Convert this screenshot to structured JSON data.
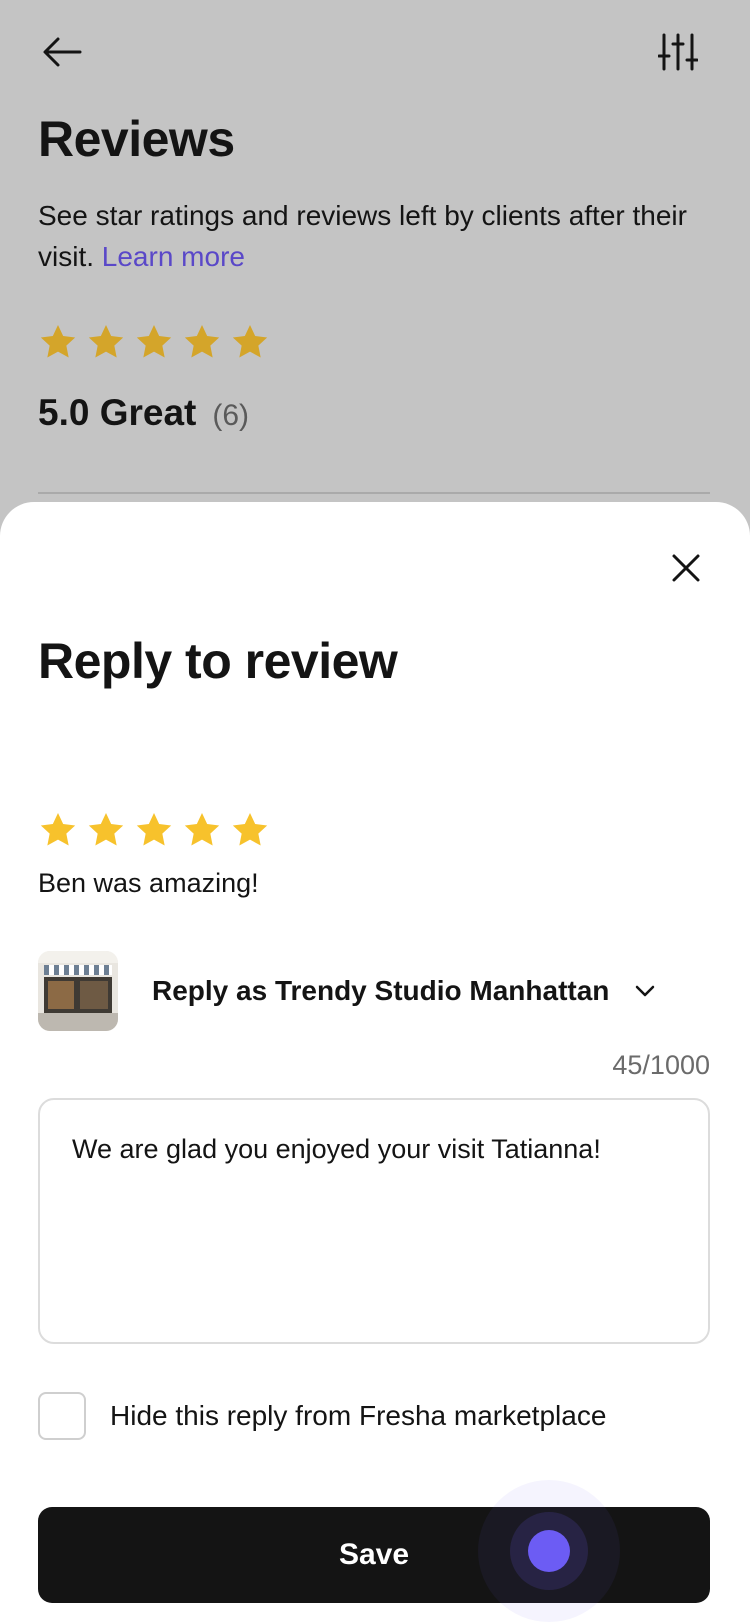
{
  "background_page": {
    "title": "Reviews",
    "description": "See star ratings and reviews left by clients after their visit.",
    "learn_more": "Learn more",
    "star_count": 5,
    "rating": "5.0 Great",
    "review_count": "(6)",
    "icons": {
      "back": "arrow-left-icon",
      "filter": "sliders-icon"
    }
  },
  "sheet": {
    "title": "Reply to review",
    "close_icon": "close-icon",
    "review": {
      "stars": 5,
      "text": "Ben was amazing!"
    },
    "reply_as_label": "Reply as Trendy Studio Manhattan",
    "char_count": "45/1000",
    "reply_text": "We are glad you enjoyed your visit Tatianna!",
    "hide_label": "Hide this reply from Fresha marketplace",
    "hide_checked": false,
    "save_label": "Save"
  },
  "colors": {
    "star_bg": "#d4a52a",
    "star_sheet": "#f7c22c",
    "link": "#5a48c8",
    "button": "#141414",
    "touch": "#6c5cf4"
  }
}
